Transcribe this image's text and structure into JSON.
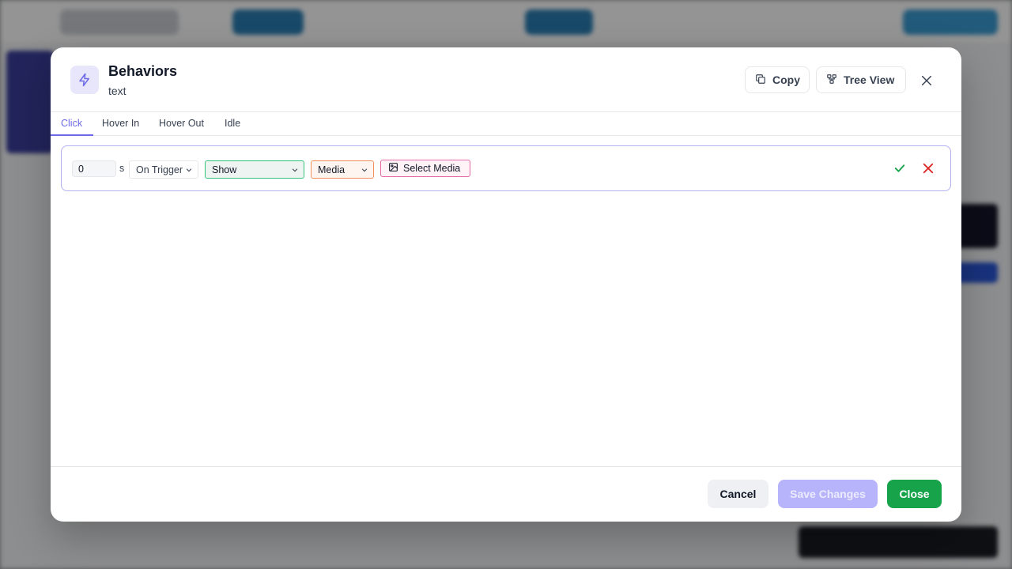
{
  "modal": {
    "title": "Behaviors",
    "subtitle": "text",
    "copy_label": "Copy",
    "tree_view_label": "Tree View"
  },
  "tabs": [
    {
      "label": "Click",
      "active": true
    },
    {
      "label": "Hover In",
      "active": false
    },
    {
      "label": "Hover Out",
      "active": false
    },
    {
      "label": "Idle",
      "active": false
    }
  ],
  "behavior_row": {
    "delay_value": "0",
    "delay_unit": "s",
    "trigger": "On Trigger",
    "action": "Show",
    "target_type": "Media",
    "select_media_label": "Select Media"
  },
  "footer": {
    "cancel_label": "Cancel",
    "save_label": "Save Changes",
    "close_label": "Close"
  },
  "colors": {
    "accent": "#6d6ae8",
    "confirm": "#16a34a",
    "delete": "#dc2626"
  },
  "icons": [
    "lightning-icon",
    "copy-icon",
    "tree-icon",
    "close-icon",
    "chevron-down-icon",
    "image-icon",
    "check-icon",
    "x-icon"
  ]
}
